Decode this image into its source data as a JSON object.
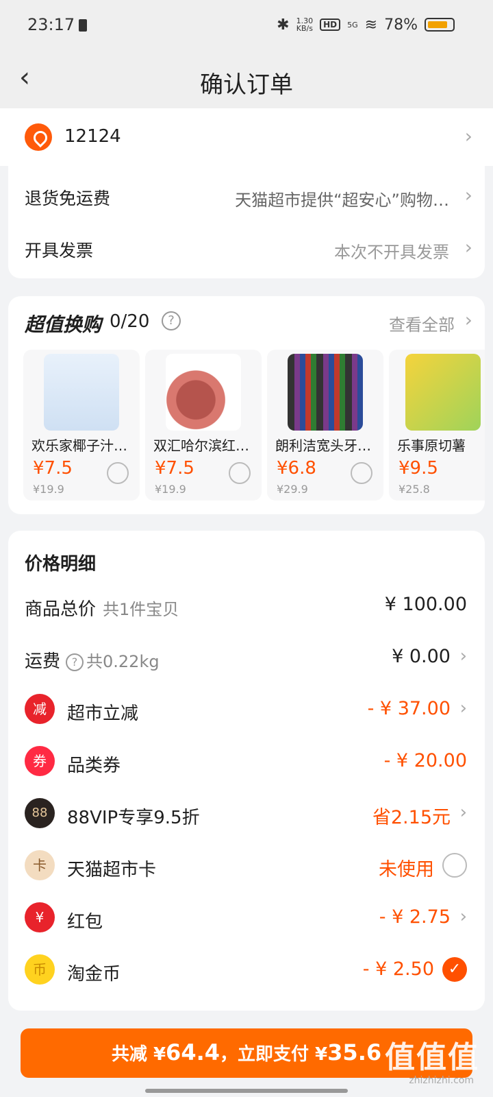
{
  "status": {
    "time": "23:17",
    "net_speed_top": "1.30",
    "net_speed_bottom": "KB/s",
    "hd": "HD",
    "signal": "5G",
    "battery": "78%"
  },
  "nav": {
    "title": "确认订单"
  },
  "address": {
    "text": "12124"
  },
  "service": {
    "return_label": "退货免运费",
    "return_value": "天猫超市提供“超安心”购物…",
    "invoice_label": "开具发票",
    "invoice_value": "本次不开具发票"
  },
  "swap": {
    "title": "超值换购",
    "count": "0/20",
    "view_all": "查看全部",
    "items": [
      {
        "name": "欢乐家椰子汁…",
        "price": "¥7.5",
        "orig": "¥19.9"
      },
      {
        "name": "双汇哈尔滨红…",
        "price": "¥7.5",
        "orig": "¥19.9"
      },
      {
        "name": "朗利洁宽头牙…",
        "price": "¥6.8",
        "orig": "¥29.9"
      },
      {
        "name": "乐事原切薯",
        "price": "¥9.5",
        "orig": "¥25.8"
      }
    ]
  },
  "price": {
    "title": "价格明细",
    "total_label": "商品总价",
    "total_sub": "共1件宝贝",
    "total_value": "¥ 100.00",
    "ship_label": "运费",
    "ship_sub": "共0.22kg",
    "ship_value": "¥ 0.00",
    "rows": [
      {
        "label": "超市立减",
        "value": "- ¥ 37.00",
        "icon": "减"
      },
      {
        "label": "品类券",
        "value": "- ¥ 20.00",
        "icon": "券"
      },
      {
        "label": "88VIP专享9.5折",
        "value": "省2.15元",
        "icon": "88"
      },
      {
        "label": "天猫超市卡",
        "value": "未使用",
        "icon": "卡"
      },
      {
        "label": "红包",
        "value": "- ¥ 2.75",
        "icon": "¥"
      },
      {
        "label": "淘金币",
        "value": "- ¥ 2.50",
        "icon": "币"
      }
    ]
  },
  "pay": {
    "prefix": "共减 ¥",
    "discount": "64.4",
    "mid": "，立即支付 ¥",
    "amount": "35.6"
  },
  "watermark": {
    "text": "值值值",
    "url": "zhizhizhi.com"
  },
  "colors": {
    "accent": "#ff5000",
    "pay_button": "#ff6a00"
  }
}
